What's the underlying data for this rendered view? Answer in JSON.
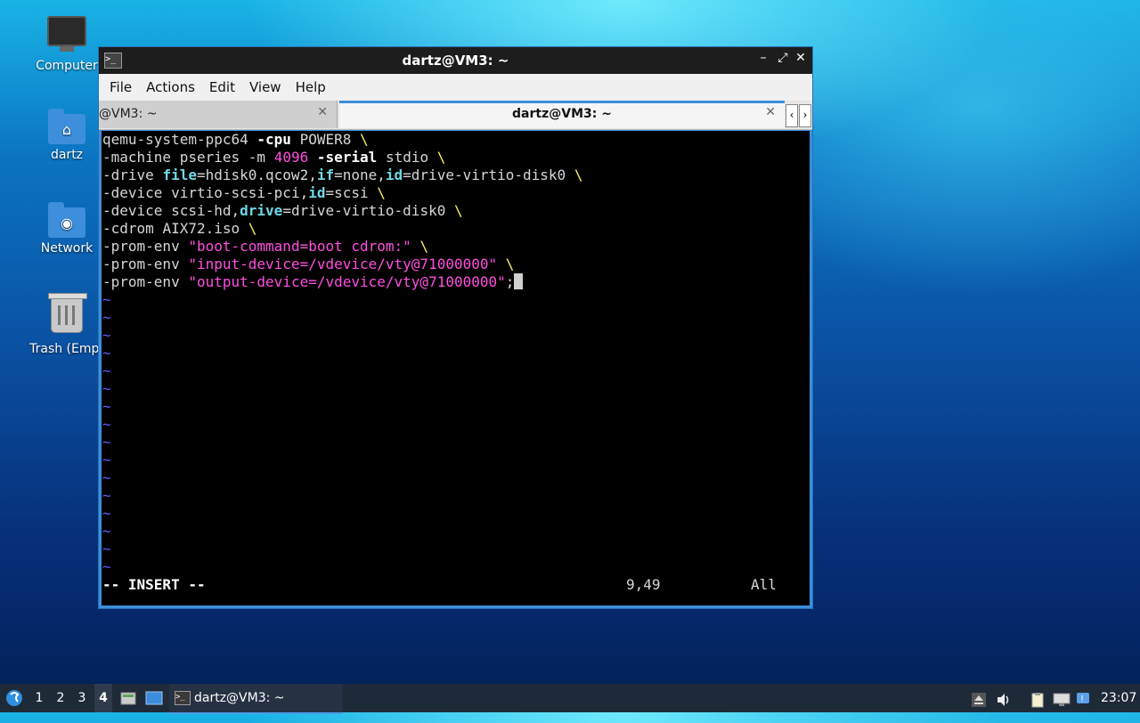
{
  "desktop": {
    "icons": [
      {
        "label": "Computer",
        "icon": "computer-icon"
      },
      {
        "label": "dartz",
        "icon": "home-folder-icon"
      },
      {
        "label": "Network",
        "icon": "network-folder-icon"
      },
      {
        "label": "Trash (Empt",
        "icon": "trash-icon"
      }
    ]
  },
  "window": {
    "title": "dartz@VM3: ~",
    "controls": {
      "minimize": "–",
      "restore": "⤢",
      "close": "✕"
    },
    "menu": [
      "File",
      "Actions",
      "Edit",
      "View",
      "Help"
    ],
    "tabs": [
      {
        "label": "@VM3: ~",
        "close": "✕"
      },
      {
        "label": "dartz@VM3: ~",
        "close": "✕"
      }
    ],
    "tab_scroll": {
      "left": "‹",
      "right": "›"
    }
  },
  "terminal": {
    "lines": [
      {
        "cmd": "qemu-system-ppc64",
        "opt": "-cpu",
        "val": "POWER8"
      },
      {
        "cmd": "-machine",
        "mid": "pseries",
        "opt": "-m",
        "num": "4096",
        "opt2": "-serial",
        "val": "stdio"
      },
      {
        "cmd": "-drive",
        "k1": "file",
        "v1": "=hdisk0.qcow2,",
        "k2": "if",
        "v2": "=none,",
        "k3": "id",
        "v3": "=drive-virtio-disk0"
      },
      {
        "cmd": "-device",
        "v1": "virtio-scsi-pci,",
        "k1": "id",
        "v2": "=scsi"
      },
      {
        "cmd": "-device",
        "v1": "scsi-hd,",
        "k1": "drive",
        "v2": "=drive-virtio-disk0"
      },
      {
        "cmd": "-cdrom",
        "v1": "AIX72.iso"
      },
      {
        "cmd": "-prom-env",
        "str": "\"boot-command=boot cdrom:\""
      },
      {
        "cmd": "-prom-env",
        "str": "\"input-device=/vdevice/vty@71000000\""
      },
      {
        "cmd": "-prom-env",
        "str": "\"output-device=/vdevice/vty@71000000\"",
        "tail": ";"
      }
    ],
    "backslash": "\\",
    "tilde": "~",
    "tilde_count": 16,
    "mode": "-- INSERT --",
    "position": "9,49",
    "scope": "All"
  },
  "taskbar": {
    "workspaces": [
      "1",
      "2",
      "3",
      "4"
    ],
    "active_workspace": "4",
    "task": "dartz@VM3: ~",
    "clock": "23:07"
  }
}
